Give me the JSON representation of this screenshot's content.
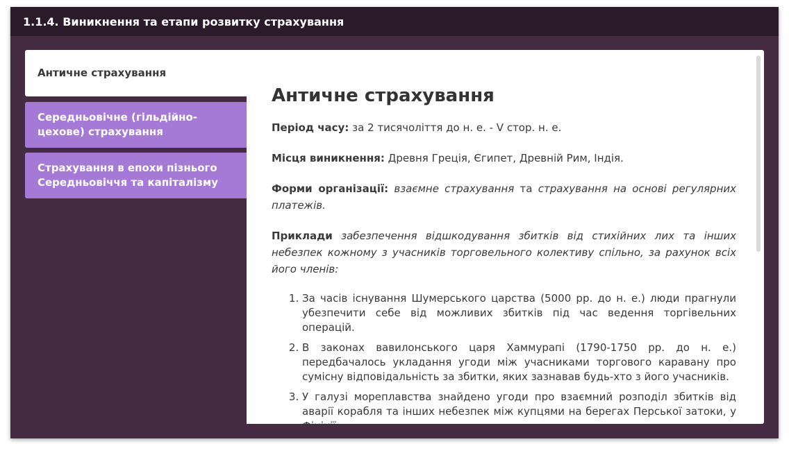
{
  "header": {
    "title": "1.1.4. Виникнення та етапи розвитку страхування"
  },
  "tabs": [
    {
      "label": "Античне страхування",
      "active": true
    },
    {
      "label": "Середньовічне (гільдійно-цехове) страхування",
      "active": false
    },
    {
      "label": "Страхування в епохи пізнього Середньовіччя та капіталізму",
      "active": false
    }
  ],
  "article": {
    "heading": "Античне страхування",
    "period": {
      "label": "Період часу:",
      "value": "за 2 тисячоліття до н. е. - V стор. н. е."
    },
    "places": {
      "label": "Місця виникнення:",
      "value": "Древня Греція, Єгипет, Древній Рим, Індія."
    },
    "forms": {
      "label": "Форми організації:",
      "form1": "взаємне страхування",
      "connector": "та",
      "form2": "страхування на основі регулярних платежів",
      "end": "."
    },
    "examples": {
      "label": "Приклади",
      "intro": "забезпечення відшкодування збитків від стихійних лих та інших небезпек кожному з учасників торговельного колективу спільно, за рахунок всіх його членів:",
      "items": [
        "За часів існування Шумерського царства (5000 рр. до н. е.) люди прагнули убезпечити себе від можливих збитків під час ведення торгівельних операцій.",
        "В законах вавилонського царя Хаммурапі (1790-1750 рр. до н. е.) передбачалось укладання угоди між учасниками торгового каравану про сумісну відповідальність за збитки, яких зазнавав будь-хто з його учасників.",
        "У галузі мореплавства знайдено угоди про взаємний розподіл збитків від аварії корабля та інших небезпек між купцями на берегах Перської затоки, у Фінікії."
      ]
    }
  },
  "colors": {
    "background": "#452c43",
    "titlebar": "#2b1a29",
    "tab_inactive": "#a47ad6",
    "tab_active": "#ffffff"
  }
}
